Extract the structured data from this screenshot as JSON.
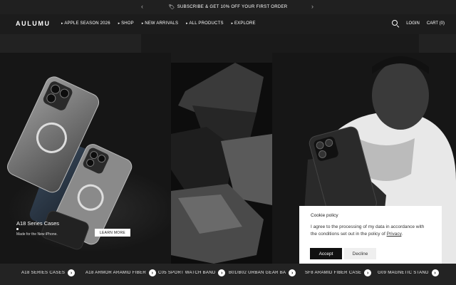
{
  "announcement": {
    "icon": "tag-icon",
    "text": "SUBSCRIBE & GET 10% OFF YOUR FIRST ORDER",
    "prev": "‹",
    "next": "›"
  },
  "header": {
    "logo": "AULUMU",
    "nav": [
      "APPLE SEASON 2026",
      "SHOP",
      "NEW ARRIVALS",
      "ALL PRODUCTS",
      "EXPLORE"
    ],
    "login": "LOGIN",
    "cart": "CART (0)"
  },
  "hero": {
    "promo_title": "A18 Series Cases",
    "promo_subtitle": "Made for the New iPhone.",
    "learn_more": "LEARN MORE"
  },
  "cookie": {
    "title": "Cookie policy",
    "text_before": "I agree to the processing of my data in accordance with the conditions set out in the policy of ",
    "link": "Privacy",
    "text_after": ".",
    "accept": "Accept",
    "decline": "Decline"
  },
  "categories": [
    "A18 SERIES CASES",
    "A18 ARMOR ARAMID FIBER",
    "C05 SPORT WATCH BAND",
    "B01/B02 URBAN GEAR BA",
    "SF8 ARAMID FIBER CASE",
    "G09 MAGNETIC STAND"
  ],
  "colors": {
    "background": "#1a1a1a",
    "header": "#1c1c1c",
    "accent": "#ffffff",
    "cookie_bg": "#ffffff",
    "accept_bg": "#111111"
  }
}
